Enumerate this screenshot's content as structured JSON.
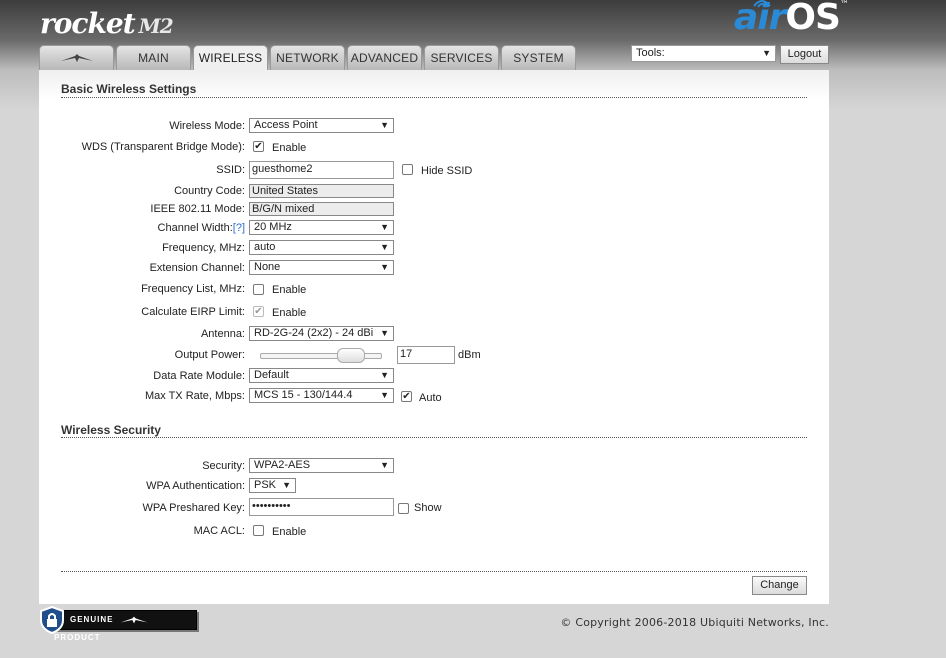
{
  "header": {
    "brand_left": "rocket",
    "brand_left_model": "M2",
    "brand_right_air": "air",
    "brand_right_os": "OS",
    "brand_right_tm": "™"
  },
  "tabs": [
    {
      "label": "",
      "icon": "ubiquiti-logo-icon"
    },
    {
      "label": "MAIN"
    },
    {
      "label": "WIRELESS",
      "active": true
    },
    {
      "label": "NETWORK"
    },
    {
      "label": "ADVANCED"
    },
    {
      "label": "SERVICES"
    },
    {
      "label": "SYSTEM"
    }
  ],
  "tools": {
    "selected": "Tools:",
    "logout_label": "Logout"
  },
  "basic": {
    "title": "Basic Wireless Settings",
    "wireless_mode_label": "Wireless Mode:",
    "wireless_mode_value": "Access Point",
    "wds_label": "WDS (Transparent Bridge Mode):",
    "wds_enable": "Enable",
    "ssid_label": "SSID:",
    "ssid_value": "guesthome2",
    "hide_ssid": "Hide SSID",
    "country_label": "Country Code:",
    "country_value": "United States",
    "ieee_label": "IEEE 802.11 Mode:",
    "ieee_value": "B/G/N mixed",
    "channel_width_label": "Channel Width:",
    "channel_width_help": "[?]",
    "channel_width_value": "20 MHz",
    "frequency_label": "Frequency, MHz:",
    "frequency_value": "auto",
    "extension_label": "Extension Channel:",
    "extension_value": "None",
    "freq_list_label": "Frequency List, MHz:",
    "freq_list_enable": "Enable",
    "eirp_label": "Calculate EIRP Limit:",
    "eirp_enable": "Enable",
    "antenna_label": "Antenna:",
    "antenna_value": "RD-2G-24 (2x2) - 24 dBi",
    "output_power_label": "Output Power:",
    "output_power_value": "17",
    "output_power_unit": "dBm",
    "data_rate_label": "Data Rate Module:",
    "data_rate_value": "Default",
    "max_tx_label": "Max TX Rate, Mbps:",
    "max_tx_value": "MCS 15 - 130/144.4",
    "max_tx_auto": "Auto"
  },
  "security": {
    "title": "Wireless Security",
    "security_label": "Security:",
    "security_value": "WPA2-AES",
    "wpa_auth_label": "WPA Authentication:",
    "wpa_auth_value": "PSK",
    "wpa_key_label": "WPA Preshared Key:",
    "wpa_key_value": "••••••••••",
    "show_label": "Show",
    "mac_acl_label": "MAC ACL:",
    "mac_acl_enable": "Enable"
  },
  "change_label": "Change",
  "footer": {
    "genuine_left": "GENUINE",
    "genuine_right": "PRODUCT",
    "copyright": "© Copyright 2006-2018 Ubiquiti Networks, Inc."
  },
  "colors": {
    "accent": "#2a8ad6",
    "help_link": "#2a6fd0"
  }
}
